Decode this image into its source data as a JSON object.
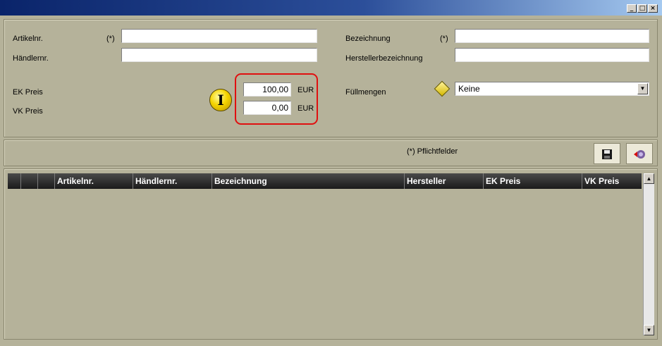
{
  "window": {
    "controls": {
      "minimize": "_",
      "maximize": "□",
      "close": "×"
    }
  },
  "form": {
    "artikelnr": {
      "label": "Artikelnr.",
      "required_marker": "(*)",
      "value": ""
    },
    "haendlernr": {
      "label": "Händlernr.",
      "value": ""
    },
    "bezeichnung": {
      "label": "Bezeichnung",
      "required_marker": "(*)",
      "value": ""
    },
    "herstellerbezeichnung": {
      "label": "Herstellerbezeichnung",
      "value": ""
    },
    "ek_preis": {
      "label": "EK Preis",
      "value": "100,00",
      "unit": "EUR"
    },
    "vk_preis": {
      "label": "VK Preis",
      "value": "0,00",
      "unit": "EUR"
    },
    "fuellmengen": {
      "label": "Füllmengen",
      "selected": "Keine"
    }
  },
  "toolbar": {
    "required_note": "(*) Pflichtfelder"
  },
  "grid": {
    "columns": [
      "",
      "",
      "",
      "Artikelnr.",
      "Händlernr.",
      "Bezeichnung",
      "Hersteller",
      "EK Preis",
      "VK Preis"
    ],
    "rows": []
  },
  "icons": {
    "info": "info-icon",
    "diamond": "diamond-icon",
    "save": "save-icon",
    "reset": "reset-icon"
  },
  "colors": {
    "background": "#b5b29a",
    "highlight": "#e01010",
    "header_bg": "#1a1a1a"
  }
}
